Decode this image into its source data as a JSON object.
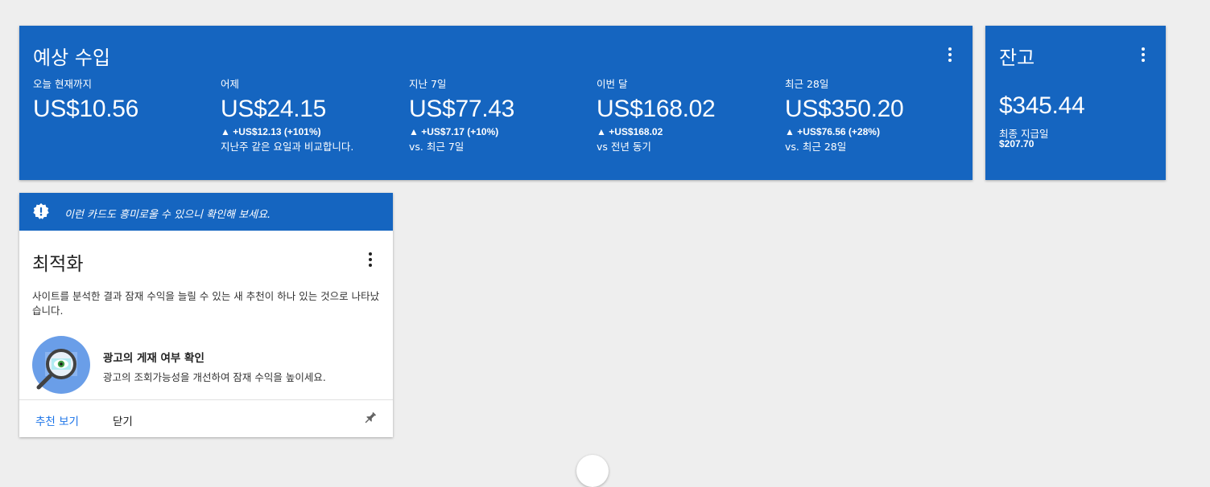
{
  "earnings": {
    "title": "예상 수입",
    "menu_icon": "more-vert-icon",
    "metrics": [
      {
        "label": "오늘 현재까지",
        "value": "US$10.56",
        "delta": "",
        "note": ""
      },
      {
        "label": "어제",
        "value": "US$24.15",
        "delta": "▲ +US$12.13 (+101%)",
        "note": "지난주 같은 요일과 비교합니다."
      },
      {
        "label": "지난 7일",
        "value": "US$77.43",
        "delta": "▲ +US$7.17 (+10%)",
        "note": "vs. 최근 7일"
      },
      {
        "label": "이번 달",
        "value": "US$168.02",
        "delta": "▲ +US$168.02",
        "note": "vs 전년 동기"
      },
      {
        "label": "최근 28일",
        "value": "US$350.20",
        "delta": "▲ +US$76.56 (+28%)",
        "note": "vs. 최근 28일"
      }
    ]
  },
  "balance": {
    "title": "잔고",
    "value": "$345.44",
    "last_payment_label": "최종 지급일",
    "last_payment_value": "$207.70",
    "menu_icon": "more-vert-icon"
  },
  "optimization": {
    "banner_text": "이런 카드도 흥미로울 수 있으니 확인해 보세요.",
    "banner_icon": "alert-badge-icon",
    "title": "최적화",
    "description": "사이트를 분석한 결과 잠재 수익을 늘릴 수 있는 새 추천이 하나 있는 것으로 나타났습니다.",
    "recommendation_title": "광고의 게재 여부 확인",
    "recommendation_subtitle": "광고의 조회가능성을 개선하여 잠재 수익을 높이세요.",
    "illustration_icon": "magnifier-eye-icon",
    "primary_action": "추천 보기",
    "secondary_action": "닫기",
    "pin_icon": "pin-icon"
  },
  "colors": {
    "card_blue": "#1565c0",
    "background": "#eeeeee",
    "link_blue": "#1a73e8"
  }
}
